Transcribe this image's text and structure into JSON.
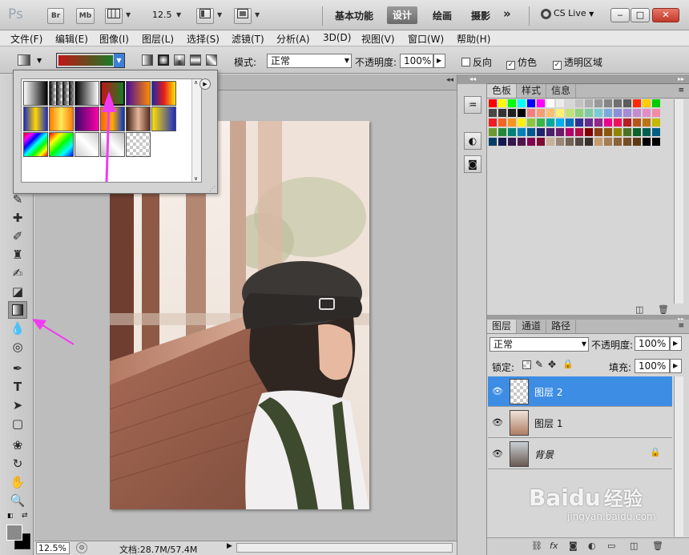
{
  "appbar": {
    "logo": "Ps",
    "bridge_label": "Br",
    "minibridge_label": "Mb",
    "zoom": "12.5",
    "workspaces": [
      "基本功能",
      "设计",
      "绘画",
      "摄影"
    ],
    "active_workspace": "设计",
    "more": "»",
    "cs_live": "CS Live"
  },
  "menu": [
    "文件(F)",
    "编辑(E)",
    "图像(I)",
    "图层(L)",
    "选择(S)",
    "滤镜(T)",
    "分析(A)",
    "3D(D)",
    "视图(V)",
    "窗口(W)",
    "帮助(H)"
  ],
  "options": {
    "mode_label": "模式:",
    "mode_value": "正常",
    "opacity_label": "不透明度:",
    "opacity_value": "100%",
    "reverse_label": "反向",
    "reverse_checked": false,
    "dither_label": "仿色",
    "dither_checked": true,
    "transparency_label": "透明区域",
    "transparency_checked": true,
    "current_gradient": [
      "#c21515",
      "#1a7a26"
    ]
  },
  "status": {
    "zoom": "12.5%",
    "doc_info": "文档:28.7M/57.4M"
  },
  "swatches_panel": {
    "tabs": [
      "色板",
      "样式",
      "信息"
    ]
  },
  "layers_panel": {
    "tabs": [
      "图层",
      "通道",
      "路径"
    ],
    "blend_mode": "正常",
    "opacity_label": "不透明度:",
    "opacity_value": "100%",
    "lock_label": "锁定:",
    "fill_label": "填充:",
    "fill_value": "100%",
    "layers": [
      {
        "name": "图层 2",
        "selected": true,
        "locked": false
      },
      {
        "name": "图层 1",
        "selected": false,
        "locked": false
      },
      {
        "name": "背景",
        "selected": false,
        "locked": true
      }
    ]
  },
  "watermark": {
    "main": "Bai",
    "paw": "du",
    "cn": "经验",
    "url": "jingyan.baidu.com"
  },
  "swatch_colors": [
    [
      "#ff0000",
      "#ffff00",
      "#00ff00",
      "#00ffff",
      "#0000ff",
      "#ff00ff",
      "#ffffff",
      "#ebebeb",
      "#d6d6d6",
      "#c2c2c2",
      "#adadad",
      "#999999",
      "#858585",
      "#707070",
      "#5c5c5c",
      "#ff2a00",
      "#ffcc00",
      "#00cc00"
    ],
    [
      "#474747",
      "#333333",
      "#1f1f1f",
      "#000000",
      "#f27f7f",
      "#f59d73",
      "#f8c16f",
      "#fff270",
      "#c2e472",
      "#8fd37c",
      "#7ecba3",
      "#77cbd6",
      "#7ba9db",
      "#8c8ddb",
      "#a48cd6",
      "#c38cd0",
      "#e28dc8",
      "#f28ba5"
    ],
    [
      "#ee1d24",
      "#f26522",
      "#f7941d",
      "#fff200",
      "#8dc63f",
      "#39b54a",
      "#00a99d",
      "#00aeef",
      "#0072bc",
      "#2e3192",
      "#662d91",
      "#92278f",
      "#ec008c",
      "#ed145b",
      "#b61f24",
      "#b8541a",
      "#bc7514",
      "#c4b800"
    ],
    [
      "#6c9a2e",
      "#23893a",
      "#008275",
      "#0082b8",
      "#00578f",
      "#20236d",
      "#4c1f6b",
      "#6c1b6a",
      "#b1006a",
      "#b20e45",
      "#800000",
      "#8b3e11",
      "#8d580b",
      "#8f8600",
      "#4e7123",
      "#0d632a",
      "#005e54",
      "#005e87"
    ],
    [
      "#003f69",
      "#15184f",
      "#37164e",
      "#50144d",
      "#81004d",
      "#800935",
      "#c7b299",
      "#998675",
      "#736357",
      "#534741",
      "#372f2a",
      "#c69c6d",
      "#a67c52",
      "#8c6239",
      "#754c24",
      "#603913",
      "#000000",
      "#000000"
    ]
  ],
  "gradient_presets": [
    {
      "stops": [
        "#ffffff",
        "#000000"
      ]
    },
    {
      "stops": [
        "#000000",
        "transparent"
      ]
    },
    {
      "stops": [
        "#000000",
        "#ffffff"
      ]
    },
    {
      "stops": [
        "#c21515",
        "#1a7a26"
      ]
    },
    {
      "stops": [
        "#4a0a9a",
        "#ff8a00"
      ]
    },
    {
      "stops": [
        "#1b2aa8",
        "#e61b1b",
        "#ffe400"
      ]
    },
    {
      "stops": [
        "#1c2cc0",
        "#ffd800",
        "#1c2cc0"
      ]
    },
    {
      "stops": [
        "#ff7a00",
        "#ffe95a",
        "#ff7a00"
      ]
    },
    {
      "stops": [
        "#3a0a6a",
        "#ff00aa"
      ]
    },
    {
      "stops": [
        "#ff6600",
        "#ffaa00",
        "#0033cc"
      ]
    },
    {
      "stops": [
        "#3b1e14",
        "#e7b59a",
        "#5a2e1e"
      ]
    },
    {
      "stops": [
        "#ffe100",
        "#1c2cc0"
      ]
    },
    {
      "stops": [
        "#ff0000",
        "#ff00ff",
        "#0000ff",
        "#00ffff",
        "#00ff00",
        "#ffff00",
        "#ff0000"
      ]
    },
    {
      "stops": [
        "#ff0000",
        "#ffff00",
        "#00ff00",
        "#00ffff",
        "#0000ff"
      ]
    },
    {
      "stops": [
        "#cccccc",
        "#ffffff",
        "#cccccc"
      ]
    },
    {
      "stops": [
        "#bbbbbb",
        "#ffffff",
        "#bbbbbb"
      ]
    },
    {
      "stops": [
        "transparent",
        "transparent"
      ]
    }
  ]
}
